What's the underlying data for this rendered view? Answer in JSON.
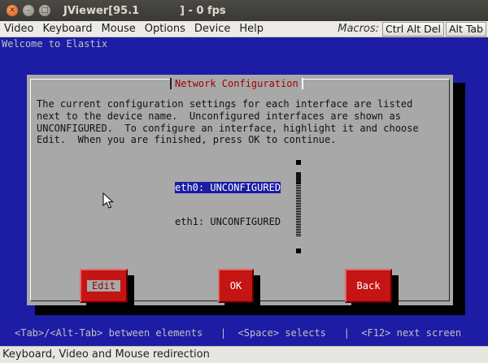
{
  "window": {
    "title": "JViewer[95.1           ] - 0 fps"
  },
  "menubar": {
    "items": [
      "Video",
      "Keyboard",
      "Mouse",
      "Options",
      "Device",
      "Help"
    ],
    "macros_label": "Macros:",
    "macro_buttons": [
      "Ctrl Alt Del",
      "Alt Tab"
    ]
  },
  "console": {
    "welcome": "Welcome to Elastix",
    "dialog": {
      "title": "Network Configuration",
      "text": "The current configuration settings for each interface are listed\nnext to the device name.  Unconfigured interfaces are shown as\nUNCONFIGURED.  To configure an interface, highlight it and choose\nEdit.  When you are finished, press OK to continue.",
      "interfaces": [
        {
          "label": "eth0: UNCONFIGURED",
          "selected": true
        },
        {
          "label": "eth1: UNCONFIGURED",
          "selected": false
        }
      ],
      "buttons": {
        "edit": "Edit",
        "ok": "OK",
        "back": "Back"
      }
    },
    "hint": "<Tab>/<Alt-Tab> between elements   |  <Space> selects   |  <F12> next screen"
  },
  "statusbar": {
    "text": "Keyboard, Video and Mouse redirection"
  },
  "colors": {
    "console_bg": "#1c1ca5",
    "dialog_bg": "#a8a8a8",
    "button_red": "#c41414",
    "title_red": "#a40000"
  }
}
